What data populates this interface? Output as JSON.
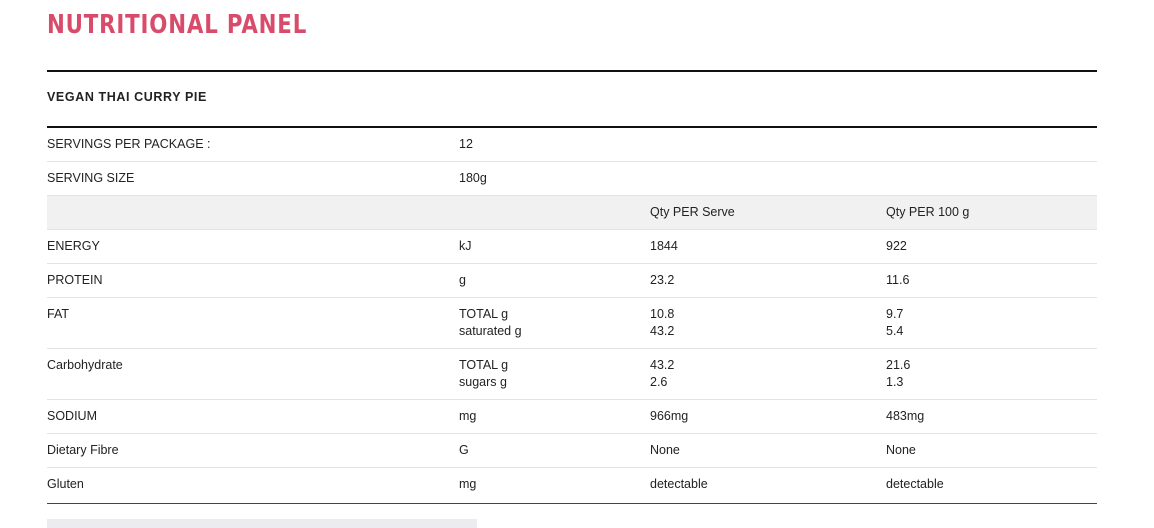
{
  "panel": {
    "title": "NUTRITIONAL PANEL",
    "accent_color": "#d94b6a"
  },
  "product": {
    "name": "VEGAN THAI CURRY PIE"
  },
  "servings": {
    "per_package_label": "SERVINGS PER PACKAGE :",
    "per_package_value": "12",
    "size_label": "SERVING SIZE",
    "size_value": "180g"
  },
  "columns": {
    "per_serve": "Qty PER Serve",
    "per_100g": "Qty PER 100 g"
  },
  "rows": [
    {
      "name": "ENERGY",
      "unit": "kJ",
      "per_serve": "1844",
      "per_100g": "922"
    },
    {
      "name": "PROTEIN",
      "unit": "g",
      "per_serve": "23.2",
      "per_100g": "11.6"
    },
    {
      "name": "FAT",
      "unit": "TOTAL g",
      "unit2": "saturated g",
      "per_serve": "10.8",
      "per_serve2": "43.2",
      "per_100g": "9.7",
      "per_100g2": "5.4"
    },
    {
      "name": "Carbohydrate",
      "unit": "TOTAL g",
      "unit2": "sugars g",
      "per_serve": "43.2",
      "per_serve2": "2.6",
      "per_100g": "21.6",
      "per_100g2": "1.3"
    },
    {
      "name": "SODIUM",
      "unit": "mg",
      "per_serve": "966mg",
      "per_100g": "483mg"
    },
    {
      "name": "Dietary Fibre",
      "unit": "G",
      "per_serve": "None",
      "per_100g": "None"
    },
    {
      "name": "Gluten",
      "unit": "mg",
      "per_serve": "detectable",
      "per_100g": "detectable"
    }
  ]
}
